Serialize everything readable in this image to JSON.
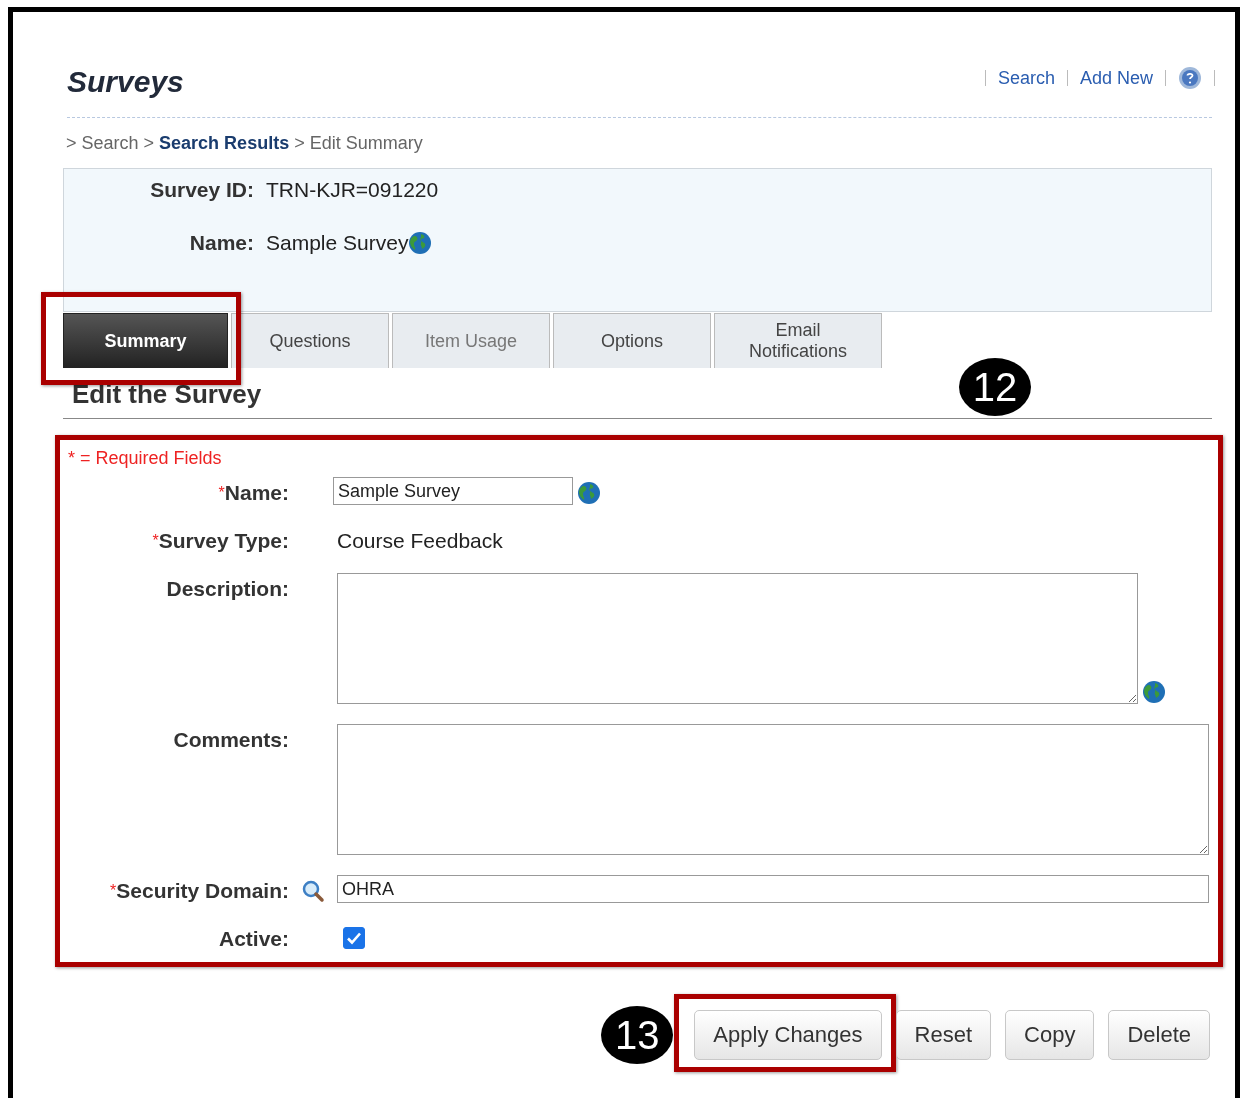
{
  "header": {
    "title": "Surveys",
    "links": [
      {
        "kind": "link",
        "label": "Search"
      },
      {
        "kind": "link",
        "label": "Add New"
      },
      {
        "kind": "help"
      }
    ]
  },
  "breadcrumb": [
    {
      "prefix": ">",
      "label": "Search",
      "kind": "plain"
    },
    {
      "prefix": ">",
      "label": "Search Results",
      "kind": "link"
    },
    {
      "prefix": ">",
      "label": "Edit Summary",
      "kind": "plain"
    }
  ],
  "info": [
    {
      "label": "Survey ID:",
      "value": "TRN-KJR=091220",
      "translatable": false
    },
    {
      "label": "Name:",
      "value": "Sample Survey",
      "translatable": true
    }
  ],
  "tabs": [
    {
      "label": "Summary",
      "selected": true,
      "disabled": false,
      "highlighted": true
    },
    {
      "label": "Questions",
      "selected": false,
      "disabled": false,
      "highlighted": false
    },
    {
      "label": "Item Usage",
      "selected": false,
      "disabled": true,
      "highlighted": false
    },
    {
      "label": "Options",
      "selected": false,
      "disabled": false,
      "highlighted": false
    },
    {
      "label": "Email Notifications",
      "selected": false,
      "disabled": false,
      "highlighted": false
    }
  ],
  "section_title": "Edit the Survey",
  "form": {
    "highlighted": true,
    "required_mark": "*",
    "required_note": "* = Required Fields",
    "callout": "12",
    "fields": [
      {
        "kind": "input",
        "label": "Name:",
        "required": true,
        "translatable": true,
        "value": "Sample Survey"
      },
      {
        "kind": "text",
        "label": "Survey Type:",
        "required": true,
        "translatable": false,
        "value": "Course Feedback"
      },
      {
        "kind": "textarea",
        "label": "Description:",
        "required": false,
        "translatable": true
      },
      {
        "kind": "textarea",
        "label": "Comments:",
        "required": false,
        "translatable": false
      },
      {
        "kind": "lookup",
        "label": "Security Domain:",
        "required": true,
        "translatable": false,
        "value": "OHRA"
      },
      {
        "kind": "checkbox",
        "label": "Active:",
        "required": false,
        "translatable": false,
        "checked": true
      }
    ]
  },
  "buttons": [
    {
      "label": "Apply Changes",
      "highlighted": true,
      "callout": "13"
    },
    {
      "label": "Reset",
      "highlighted": false
    },
    {
      "label": "Copy",
      "highlighted": false
    },
    {
      "label": "Delete",
      "highlighted": false
    }
  ]
}
